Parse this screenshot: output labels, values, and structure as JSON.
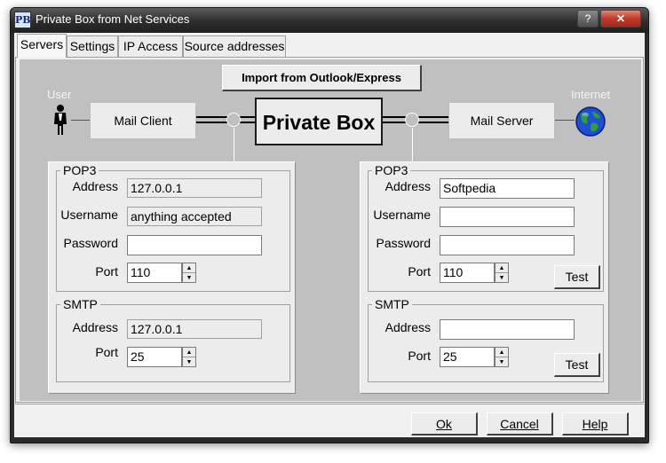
{
  "window": {
    "title": "Private Box from Net Services",
    "app_icon": "PB",
    "help_glyph": "?",
    "close_glyph": "✕"
  },
  "tabs": [
    "Servers",
    "Settings",
    "IP Access",
    "Source addresses"
  ],
  "diagram": {
    "import_button": "Import from Outlook/Express",
    "user_label": "User",
    "internet_label": "Internet",
    "mail_client": "Mail Client",
    "private_box": "Private Box",
    "mail_server": "Mail Server"
  },
  "left": {
    "pop3": {
      "legend": "POP3",
      "address_label": "Address",
      "address": "127.0.0.1",
      "username_label": "Username",
      "username": "anything accepted",
      "password_label": "Password",
      "password": "",
      "port_label": "Port",
      "port": "110"
    },
    "smtp": {
      "legend": "SMTP",
      "address_label": "Address",
      "address": "127.0.0.1",
      "port_label": "Port",
      "port": "25"
    }
  },
  "right": {
    "pop3": {
      "legend": "POP3",
      "address_label": "Address",
      "address": "Softpedia",
      "username_label": "Username",
      "username": "",
      "password_label": "Password",
      "password": "",
      "port_label": "Port",
      "port": "110",
      "test_label": "Test"
    },
    "smtp": {
      "legend": "SMTP",
      "address_label": "Address",
      "address": "",
      "port_label": "Port",
      "port": "25",
      "test_label": "Test"
    }
  },
  "footer": {
    "ok": "Ok",
    "cancel": "Cancel",
    "help": "Help"
  }
}
